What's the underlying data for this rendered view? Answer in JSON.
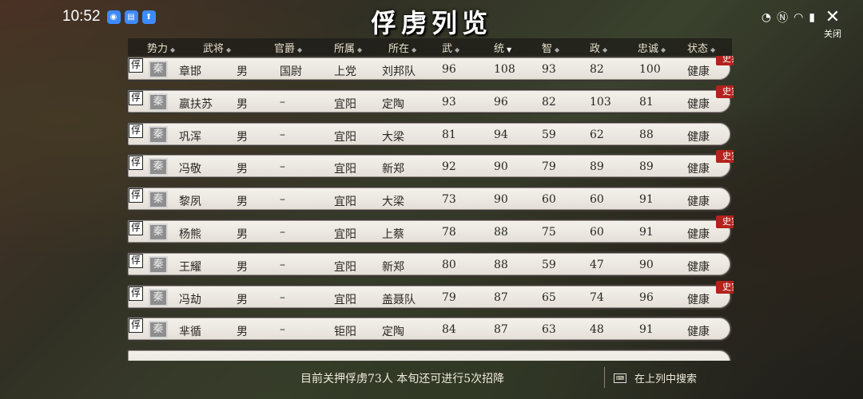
{
  "status_bar": {
    "time": "10:52"
  },
  "title": "俘虏列览",
  "close_label": "关闭",
  "columns": [
    "势力",
    "武将",
    "官爵",
    "所属",
    "所在",
    "武",
    "统",
    "智",
    "政",
    "忠诚",
    "状态"
  ],
  "badge_fu": "俘",
  "faction_label": "秦",
  "historical_badge": "史实",
  "rows": [
    {
      "name": "章邯",
      "gender": "男",
      "rank": "国尉",
      "belong": "上党",
      "location": "刘邦队",
      "wu": "96",
      "tong": "108",
      "zhi": "93",
      "zheng": "82",
      "loyalty": "100",
      "status": "健康",
      "historical": true
    },
    {
      "name": "嬴扶苏",
      "gender": "男",
      "rank": "–",
      "belong": "宜阳",
      "location": "定陶",
      "wu": "93",
      "tong": "96",
      "zhi": "82",
      "zheng": "103",
      "loyalty": "81",
      "status": "健康",
      "historical": true
    },
    {
      "name": "巩浑",
      "gender": "男",
      "rank": "–",
      "belong": "宜阳",
      "location": "大梁",
      "wu": "81",
      "tong": "94",
      "zhi": "59",
      "zheng": "62",
      "loyalty": "88",
      "status": "健康",
      "historical": false
    },
    {
      "name": "冯敬",
      "gender": "男",
      "rank": "–",
      "belong": "宜阳",
      "location": "新郑",
      "wu": "92",
      "tong": "90",
      "zhi": "79",
      "zheng": "89",
      "loyalty": "89",
      "status": "健康",
      "historical": true
    },
    {
      "name": "黎夙",
      "gender": "男",
      "rank": "–",
      "belong": "宜阳",
      "location": "大梁",
      "wu": "73",
      "tong": "90",
      "zhi": "60",
      "zheng": "60",
      "loyalty": "91",
      "status": "健康",
      "historical": false
    },
    {
      "name": "杨熊",
      "gender": "男",
      "rank": "–",
      "belong": "宜阳",
      "location": "上蔡",
      "wu": "78",
      "tong": "88",
      "zhi": "75",
      "zheng": "60",
      "loyalty": "91",
      "status": "健康",
      "historical": true
    },
    {
      "name": "王耀",
      "gender": "男",
      "rank": "–",
      "belong": "宜阳",
      "location": "新郑",
      "wu": "80",
      "tong": "88",
      "zhi": "59",
      "zheng": "47",
      "loyalty": "90",
      "status": "健康",
      "historical": false
    },
    {
      "name": "冯劫",
      "gender": "男",
      "rank": "–",
      "belong": "宜阳",
      "location": "盖聂队",
      "wu": "79",
      "tong": "87",
      "zhi": "65",
      "zheng": "74",
      "loyalty": "96",
      "status": "健康",
      "historical": true
    },
    {
      "name": "芈循",
      "gender": "男",
      "rank": "–",
      "belong": "钜阳",
      "location": "定陶",
      "wu": "84",
      "tong": "87",
      "zhi": "63",
      "zheng": "48",
      "loyalty": "91",
      "status": "健康",
      "historical": false
    }
  ],
  "footer": {
    "info": "目前关押俘虏73人 本旬还可进行5次招降",
    "search_label": "在上列中搜索"
  }
}
